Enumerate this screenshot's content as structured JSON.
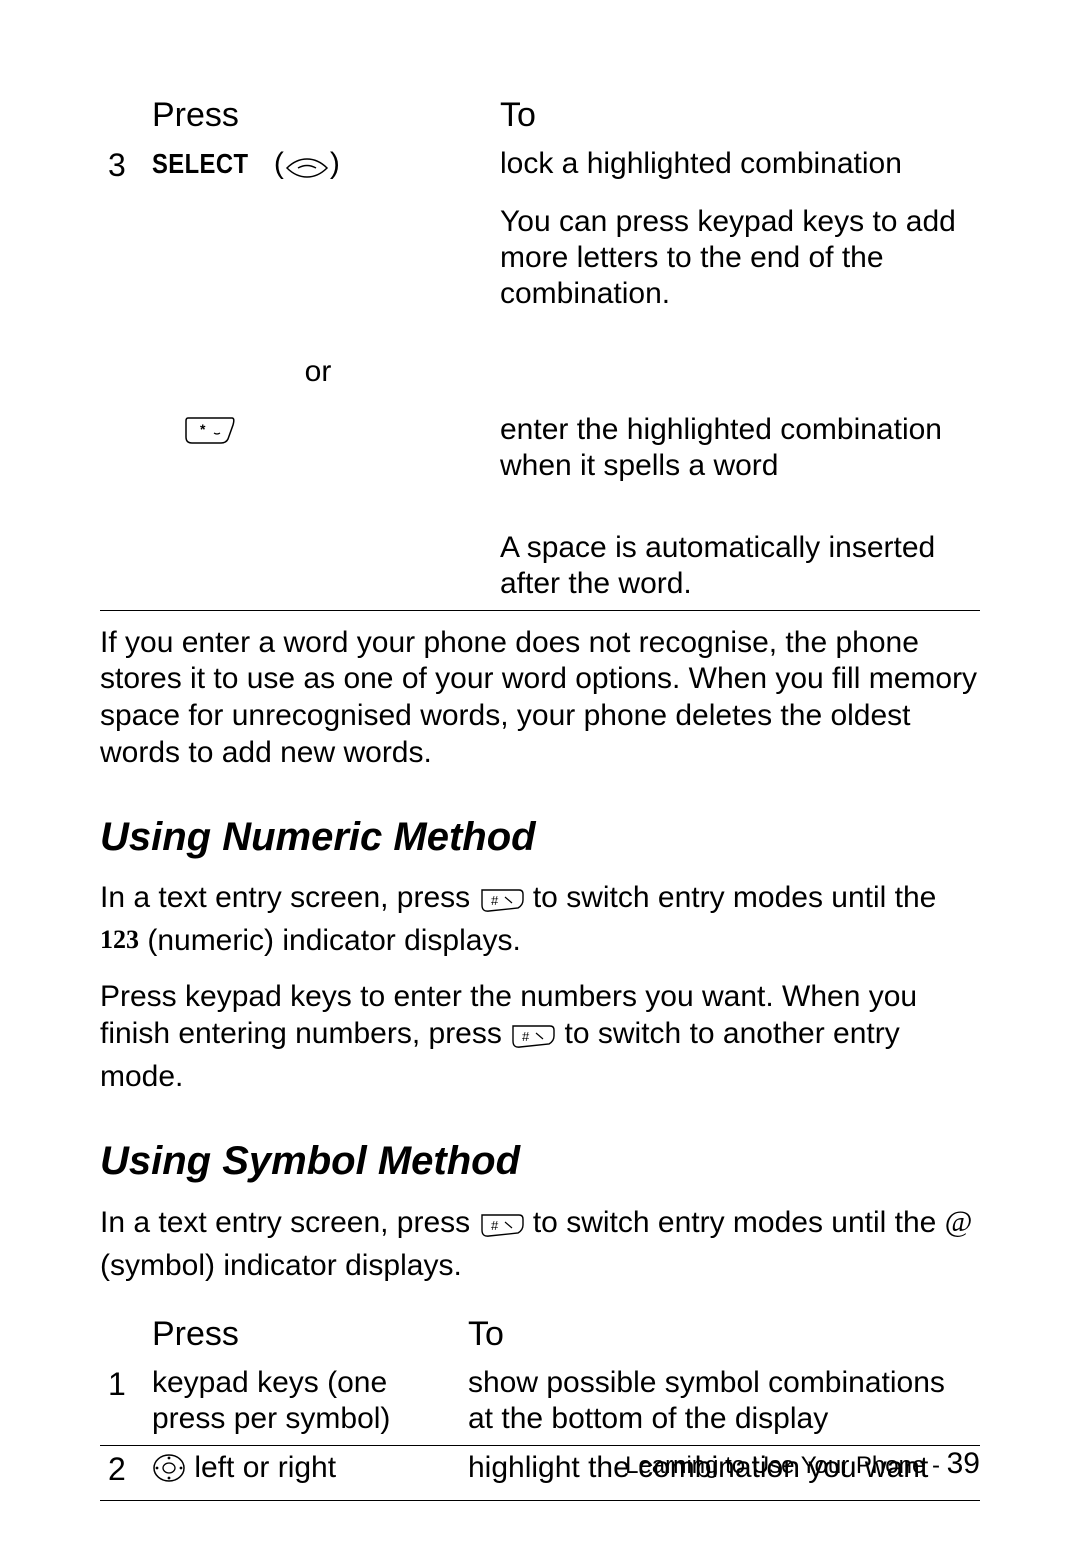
{
  "table1": {
    "head_press": "Press",
    "head_to": "To",
    "step3_num": "3",
    "select_label": "SELECT",
    "select_paren_open": "(",
    "select_paren_close": ")",
    "step3_to_a": "lock a highlighted combination",
    "step3_to_b": "You can press keypad keys to add more letters to the end of the combination.",
    "or": "or",
    "alt_to_a": "enter the highlighted combination when it spells a word",
    "alt_to_b": "A space is automatically inserted after the word."
  },
  "para_unrecognised": "If you enter a word your phone does not recognise, the phone stores it to use as one of your word options. When you fill memory space for unrecognised words, your phone deletes the oldest words to add new words.",
  "numeric": {
    "heading": "Using Numeric Method",
    "p1a": "In a text entry screen, press ",
    "p1b": " to switch entry modes until the ",
    "p1c": " (numeric) indicator displays.",
    "indicator": "123",
    "p2a": "Press keypad keys to enter the numbers you want. When you finish entering numbers, press ",
    "p2b": " to switch to another entry mode."
  },
  "symbol": {
    "heading": "Using Symbol Method",
    "p1a": "In a text entry screen, press ",
    "p1b": " to switch entry modes until the ",
    "p1c": " (symbol) indicator displays.",
    "indicator": "@"
  },
  "table2": {
    "head_press": "Press",
    "head_to": "To",
    "s1_num": "1",
    "s1_press": "keypad keys (one press per symbol)",
    "s1_to": "show possible symbol combinations at the bottom of the display",
    "s2_num": "2",
    "s2_press": " left or right",
    "s2_to": "highlight the combination you want"
  },
  "footer": {
    "label": "Learning to Use Your Phone - ",
    "page": "39"
  }
}
